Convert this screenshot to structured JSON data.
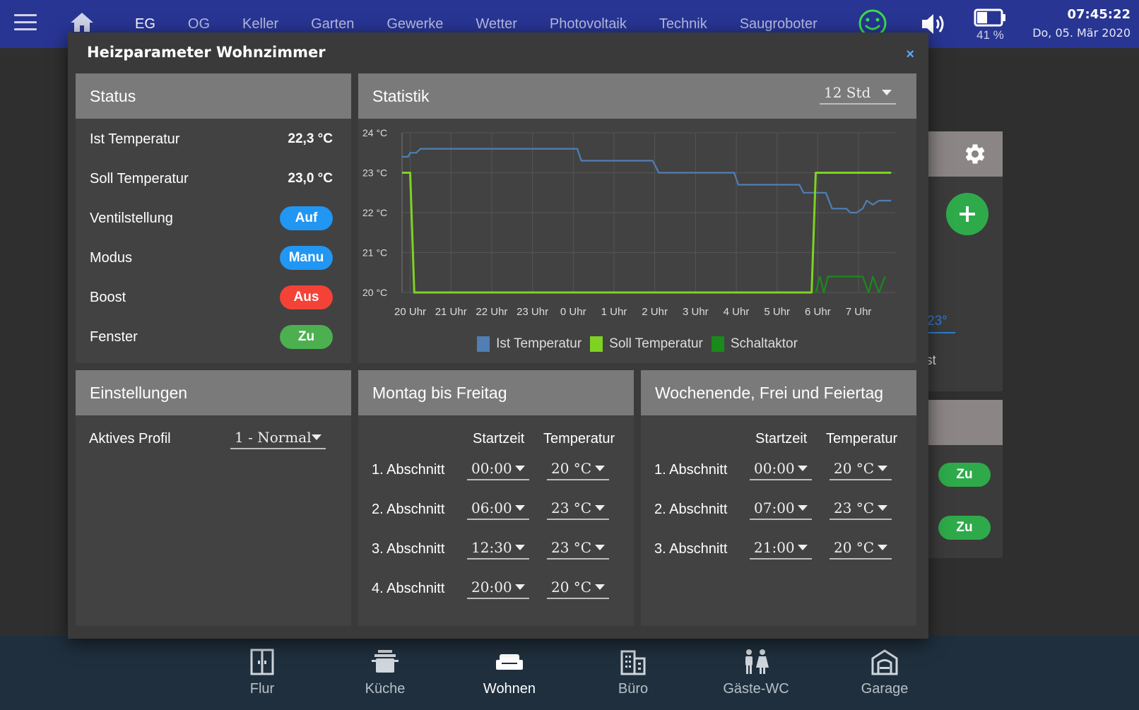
{
  "topbar": {
    "nav": [
      "EG",
      "OG",
      "Keller",
      "Garten",
      "Gewerke",
      "Wetter",
      "Photovoltaik",
      "Technik",
      "Saugroboter"
    ],
    "battery": "41 %",
    "time": "07:45:22",
    "date": "Do, 05. Mär 2020",
    "icons": [
      "hamburger-icon",
      "home-icon",
      "smiley-icon",
      "speaker-icon",
      "battery-icon"
    ]
  },
  "dialog": {
    "title": "Heizparameter Wohnzimmer",
    "close": "×",
    "status": {
      "title": "Status",
      "ist_label": "Ist Temperatur",
      "ist_value": "22,3 °C",
      "soll_label": "Soll Temperatur",
      "soll_value": "23,0 °C",
      "ventil_label": "Ventilstellung",
      "ventil_value": "Auf",
      "modus_label": "Modus",
      "modus_value": "Manu",
      "boost_label": "Boost",
      "boost_value": "Aus",
      "fenster_label": "Fenster",
      "fenster_value": "Zu"
    },
    "statistik": {
      "title": "Statistik",
      "range": "12 Std"
    },
    "einstellungen": {
      "title": "Einstellungen",
      "profil_label": "Aktives Profil",
      "profil_value": "1 - Normal"
    },
    "weekday": {
      "title": "Montag bis Freitag",
      "col_start": "Startzeit",
      "col_temp": "Temperatur",
      "rows": [
        {
          "label": "1. Abschnitt",
          "time": "00:00",
          "temp": "20 °C"
        },
        {
          "label": "2. Abschnitt",
          "time": "06:00",
          "temp": "23 °C"
        },
        {
          "label": "3. Abschnitt",
          "time": "12:30",
          "temp": "23 °C"
        },
        {
          "label": "4. Abschnitt",
          "time": "20:00",
          "temp": "20 °C"
        }
      ]
    },
    "weekend": {
      "title": "Wochenende, Frei und Feiertag",
      "col_start": "Startzeit",
      "col_temp": "Temperatur",
      "rows": [
        {
          "label": "1. Abschnitt",
          "time": "00:00",
          "temp": "20 °C"
        },
        {
          "label": "2. Abschnitt",
          "time": "07:00",
          "temp": "23 °C"
        },
        {
          "label": "3. Abschnitt",
          "time": "21:00",
          "temp": "20 °C"
        }
      ]
    }
  },
  "background": {
    "temp": "23°",
    "text": "st",
    "pill1": "Zu",
    "pill2": "Zu"
  },
  "bottombar": {
    "rooms": [
      "Flur",
      "Küche",
      "Wohnen",
      "Büro",
      "Gäste-WC",
      "Garage"
    ],
    "active": "Wohnen"
  },
  "colors": {
    "topbar": "#283593",
    "ist": "#4f7fb3",
    "soll": "#7ed321",
    "schaltaktor": "#1a8a1a",
    "pill_blue": "#2196f3",
    "pill_red": "#f44336",
    "pill_green": "#4caf50"
  },
  "chart_data": {
    "type": "line",
    "yticks": [
      "24 °C",
      "23 °C",
      "22 °C",
      "21 °C",
      "20 °C"
    ],
    "ylim": [
      20,
      24
    ],
    "xticks": [
      "20 Uhr",
      "21 Uhr",
      "22 Uhr",
      "23 Uhr",
      "0 Uhr",
      "1 Uhr",
      "2 Uhr",
      "3 Uhr",
      "4 Uhr",
      "5 Uhr",
      "6 Uhr",
      "7 Uhr"
    ],
    "x_range_hours": [
      19.8,
      31.9
    ],
    "series": [
      {
        "name": "Ist Temperatur",
        "color": "#4f7fb3",
        "points": [
          [
            19.8,
            23.4
          ],
          [
            19.95,
            23.4
          ],
          [
            20.0,
            23.5
          ],
          [
            20.15,
            23.5
          ],
          [
            20.25,
            23.6
          ],
          [
            24.1,
            23.6
          ],
          [
            24.2,
            23.3
          ],
          [
            25.95,
            23.3
          ],
          [
            26.1,
            23.0
          ],
          [
            27.95,
            23.0
          ],
          [
            28.05,
            22.7
          ],
          [
            29.55,
            22.7
          ],
          [
            29.65,
            22.5
          ],
          [
            30.2,
            22.5
          ],
          [
            30.35,
            22.1
          ],
          [
            30.7,
            22.1
          ],
          [
            30.8,
            22.0
          ],
          [
            30.95,
            22.0
          ],
          [
            31.1,
            22.1
          ],
          [
            31.2,
            22.3
          ],
          [
            31.35,
            22.2
          ],
          [
            31.5,
            22.3
          ],
          [
            31.8,
            22.3
          ]
        ]
      },
      {
        "name": "Soll Temperatur",
        "color": "#7ed321",
        "points": [
          [
            19.8,
            23.0
          ],
          [
            20.0,
            23.0
          ],
          [
            20.1,
            20.0
          ],
          [
            29.85,
            20.0
          ],
          [
            29.95,
            23.0
          ],
          [
            31.8,
            23.0
          ]
        ]
      },
      {
        "name": "Schaltaktor",
        "color": "#1a8a1a",
        "points": [
          [
            29.95,
            20.0
          ],
          [
            30.05,
            20.4
          ],
          [
            30.15,
            20.0
          ],
          [
            30.25,
            20.4
          ],
          [
            31.1,
            20.4
          ],
          [
            31.25,
            20.0
          ],
          [
            31.35,
            20.4
          ],
          [
            31.5,
            20.0
          ],
          [
            31.65,
            20.4
          ]
        ]
      }
    ]
  }
}
